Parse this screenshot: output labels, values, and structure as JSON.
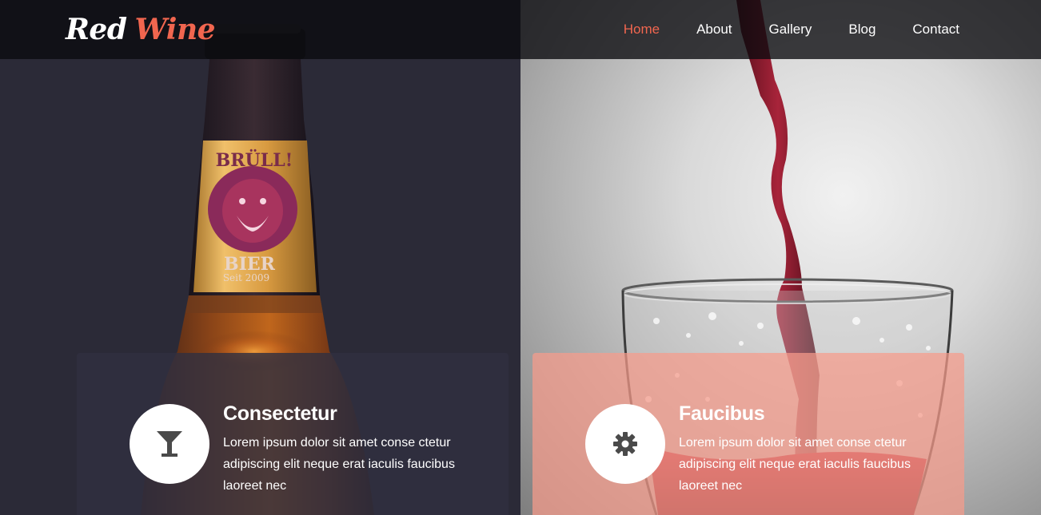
{
  "brand": {
    "part1": "Red",
    "part2": "Wine"
  },
  "nav": {
    "items": [
      {
        "label": "Home",
        "active": true
      },
      {
        "label": "About",
        "active": false
      },
      {
        "label": "Gallery",
        "active": false
      },
      {
        "label": "Blog",
        "active": false
      },
      {
        "label": "Contact",
        "active": false
      }
    ]
  },
  "hero": {
    "bottle_label": {
      "brand": "BRÜLL!",
      "type": "BIER",
      "since": "Seit 2009"
    }
  },
  "cards": [
    {
      "icon": "cocktail-glass-icon",
      "title": "Consectetur",
      "text": "Lorem ipsum dolor sit amet conse ctetur adipiscing elit neque erat iaculis faucibus laoreet nec"
    },
    {
      "icon": "gear-icon",
      "title": "Faucibus",
      "text": "Lorem ipsum dolor sit amet conse ctetur adipiscing elit neque erat iaculis faucibus laoreet nec"
    }
  ],
  "colors": {
    "accent": "#f1664f",
    "dark_panel": "#2b2a37",
    "card_dark": "#31303f",
    "card_coral": "#f69b8a"
  }
}
